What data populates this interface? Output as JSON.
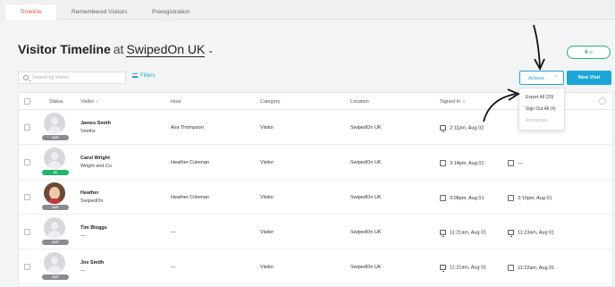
{
  "tabs": [
    {
      "label": "Timeline",
      "active": true
    },
    {
      "label": "Remembered Visitors",
      "active": false
    },
    {
      "label": "Preregistration",
      "active": false
    }
  ],
  "header": {
    "title": "Visitor Timeline",
    "at": "at",
    "location": "SwipedOn UK",
    "location_chevron": "⌄"
  },
  "onsite_count": {
    "value": "4",
    "suffix": "In"
  },
  "search": {
    "placeholder": "Search by visitor"
  },
  "filters_label": "Filters",
  "actions": {
    "label": "Actions",
    "caret": "^",
    "menu": [
      {
        "label": "Export All (20)",
        "enabled": true
      },
      {
        "label": "Sign Out All (4)",
        "enabled": true
      },
      {
        "label": "Anonymize",
        "enabled": false
      }
    ]
  },
  "new_visit_label": "New Visit",
  "columns": {
    "status": "Status",
    "visitor": "Visitor",
    "host": "Host",
    "category": "Category",
    "location": "Location",
    "signed_in": "Signed In",
    "sort_glyph": "⇕"
  },
  "rows": [
    {
      "name": "James Smith",
      "company": "Smiths",
      "host": "Ava Thompson",
      "category": "Visitor",
      "location": "SwipedOn UK",
      "signed_in": "2:11pm, Aug 02",
      "signed_out": "",
      "status": "OUT",
      "photo": false
    },
    {
      "name": "Carol Wright",
      "company": "Wright and Co",
      "host": "Heather Coleman",
      "category": "Visitor",
      "location": "SwipedOn UK",
      "signed_in": "3:14pm, Aug 01",
      "signed_out": "—",
      "status": "IN",
      "photo": false
    },
    {
      "name": "Heather",
      "company": "SwipedOn",
      "host": "Heather Coleman",
      "category": "Visitor",
      "location": "SwipedOn UK",
      "signed_in": "3:08pm, Aug 01",
      "signed_out": "3:10pm, Aug 01",
      "status": "OUT",
      "photo": true
    },
    {
      "name": "Tim Bloggs",
      "company": "—",
      "host": "—",
      "category": "Visitor",
      "location": "SwipedOn UK",
      "signed_in": "11:21am, Aug 01",
      "signed_out": "11:23am, Aug 01",
      "status": "OUT",
      "photo": false
    },
    {
      "name": "Joe Smith",
      "company": "—",
      "host": "—",
      "category": "Visitor",
      "location": "SwipedOn UK",
      "signed_in": "11:21am, Aug 01",
      "signed_out": "11:22am, Aug 01",
      "status": "OUT",
      "photo": false
    }
  ],
  "colors": {
    "accent": "#1aa7d8",
    "in": "#23b46a",
    "out": "#888c90",
    "active_tab": "#e8553c"
  }
}
